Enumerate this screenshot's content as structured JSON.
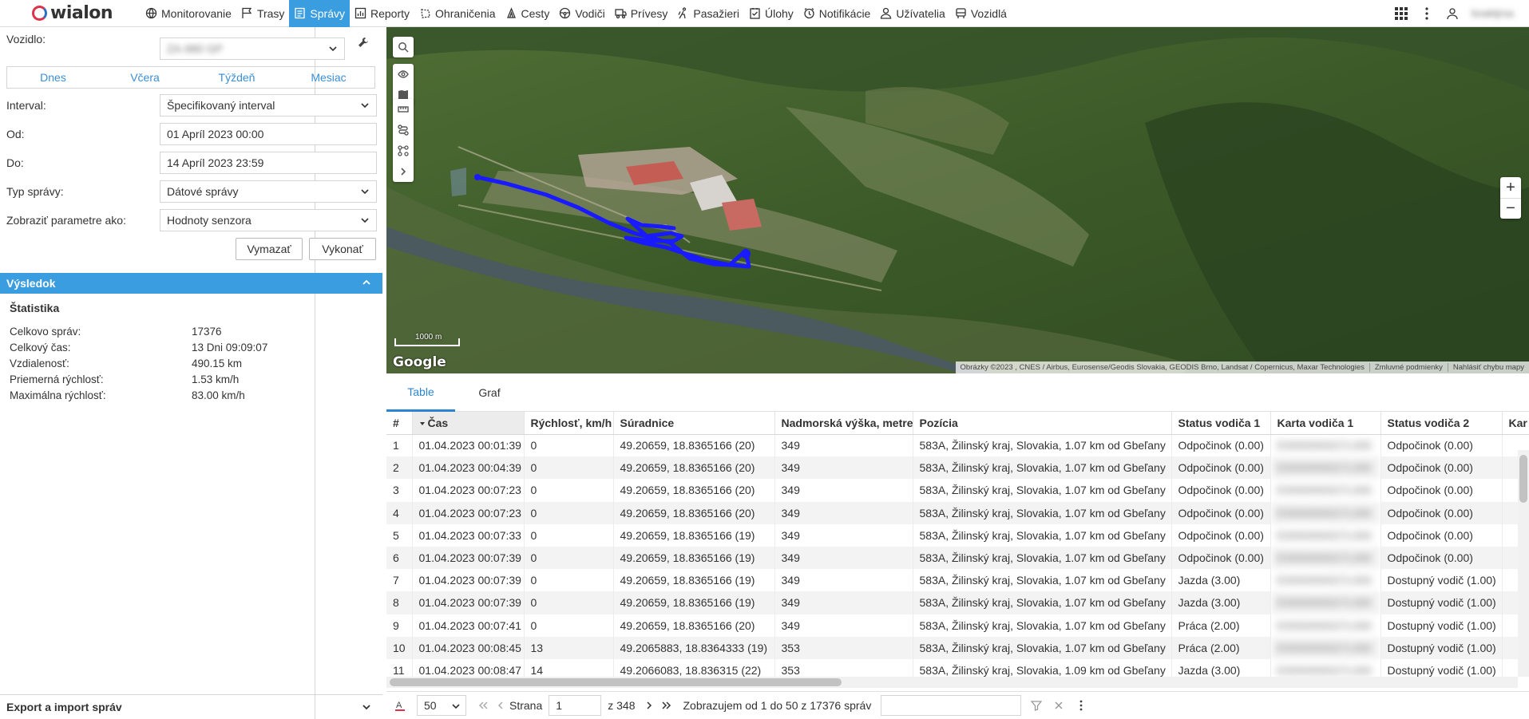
{
  "app": {
    "logo_text": "wialon",
    "username": "boaktjrsa"
  },
  "nav": [
    {
      "label": "Monitorovanie",
      "icon": "globe-icon"
    },
    {
      "label": "Trasy",
      "icon": "flag-icon"
    },
    {
      "label": "Správy",
      "icon": "messages-icon",
      "active": true
    },
    {
      "label": "Reporty",
      "icon": "report-icon"
    },
    {
      "label": "Ohraničenia",
      "icon": "geofence-icon"
    },
    {
      "label": "Cesty",
      "icon": "route-icon"
    },
    {
      "label": "Vodiči",
      "icon": "steering-wheel-icon"
    },
    {
      "label": "Prívesy",
      "icon": "trailer-icon"
    },
    {
      "label": "Pasažieri",
      "icon": "passenger-icon"
    },
    {
      "label": "Úlohy",
      "icon": "task-icon"
    },
    {
      "label": "Notifikácie",
      "icon": "notification-icon"
    },
    {
      "label": "Užívatelia",
      "icon": "user-icon"
    },
    {
      "label": "Vozidlá",
      "icon": "vehicle-icon"
    }
  ],
  "form": {
    "vehicle_label": "Vozidlo:",
    "vehicle_value": "ZA-980 GP",
    "quick": [
      "Dnes",
      "Včera",
      "Týždeň",
      "Mesiac"
    ],
    "interval_label": "Interval:",
    "interval_value": "Špecifikovaný interval",
    "from_label": "Od:",
    "from_value": "01 Apríl 2023 00:00",
    "to_label": "Do:",
    "to_value": "14 Apríl 2023 23:59",
    "type_label": "Typ správy:",
    "type_value": "Dátové správy",
    "params_label": "Zobraziť parametre ako:",
    "params_value": "Hodnoty senzora",
    "clear_label": "Vymazať",
    "execute_label": "Vykonať"
  },
  "result": {
    "header": "Výsledok",
    "stats_title": "Štatistika",
    "stats": [
      {
        "k": "Celkovo správ:",
        "v": "17376"
      },
      {
        "k": "Celkový čas:",
        "v": "13 Dni 09:09:07"
      },
      {
        "k": "Vzdialenosť:",
        "v": "490.15 km"
      },
      {
        "k": "Priemerná rýchlosť:",
        "v": "1.53 km/h"
      },
      {
        "k": "Maximálna rýchlosť:",
        "v": "83.00 km/h"
      }
    ]
  },
  "export_label": "Export a import správ",
  "map": {
    "scale_label": "1000 m",
    "google": "Google",
    "attribution": [
      "Obrázky ©2023 , CNES / Airbus, Eurosense/Geodis Slovakia, GEODIS Brno, Landsat / Copernicus, Maxar Technologies",
      "Zmluvné podmienky",
      "Nahlásiť chybu mapy"
    ],
    "zoom_in": "+",
    "zoom_out": "−",
    "track_color": "#1a1aff"
  },
  "tabs": [
    {
      "label": "Table",
      "active": true
    },
    {
      "label": "Graf"
    }
  ],
  "table": {
    "columns": [
      "#",
      "Čas",
      "Rýchlosť, km/h",
      "Súradnice",
      "Nadmorská výška, metre",
      "Pozícia",
      "Status vodiča 1",
      "Karta vodiča 1",
      "Status vodiča 2",
      "Kar"
    ],
    "rows": [
      [
        "1",
        "01.04.2023 00:01:39",
        "0",
        "49.20659, 18.8365166 (20)",
        "349",
        "583A, Žilinský kraj, Slovakia, 1.07 km od Gbeľany",
        "Odpočinok (0.00)",
        "E0000000027L000",
        "Odpočinok (0.00)"
      ],
      [
        "2",
        "01.04.2023 00:04:39",
        "0",
        "49.20659, 18.8365166 (20)",
        "349",
        "583A, Žilinský kraj, Slovakia, 1.07 km od Gbeľany",
        "Odpočinok (0.00)",
        "E0000000027L000",
        "Odpočinok (0.00)"
      ],
      [
        "3",
        "01.04.2023 00:07:23",
        "0",
        "49.20659, 18.8365166 (20)",
        "349",
        "583A, Žilinský kraj, Slovakia, 1.07 km od Gbeľany",
        "Odpočinok (0.00)",
        "E0000000027L000",
        "Odpočinok (0.00)"
      ],
      [
        "4",
        "01.04.2023 00:07:23",
        "0",
        "49.20659, 18.8365166 (20)",
        "349",
        "583A, Žilinský kraj, Slovakia, 1.07 km od Gbeľany",
        "Odpočinok (0.00)",
        "E0000000027L000",
        "Odpočinok (0.00)"
      ],
      [
        "5",
        "01.04.2023 00:07:33",
        "0",
        "49.20659, 18.8365166 (19)",
        "349",
        "583A, Žilinský kraj, Slovakia, 1.07 km od Gbeľany",
        "Odpočinok (0.00)",
        "E0000000027L000",
        "Odpočinok (0.00)"
      ],
      [
        "6",
        "01.04.2023 00:07:39",
        "0",
        "49.20659, 18.8365166 (19)",
        "349",
        "583A, Žilinský kraj, Slovakia, 1.07 km od Gbeľany",
        "Odpočinok (0.00)",
        "E0000000027L000",
        "Odpočinok (0.00)"
      ],
      [
        "7",
        "01.04.2023 00:07:39",
        "0",
        "49.20659, 18.8365166 (19)",
        "349",
        "583A, Žilinský kraj, Slovakia, 1.07 km od Gbeľany",
        "Jazda (3.00)",
        "E0000000027L000",
        "Dostupný vodič (1.00)"
      ],
      [
        "8",
        "01.04.2023 00:07:39",
        "0",
        "49.20659, 18.8365166 (19)",
        "349",
        "583A, Žilinský kraj, Slovakia, 1.07 km od Gbeľany",
        "Jazda (3.00)",
        "E0000000027L000",
        "Dostupný vodič (1.00)"
      ],
      [
        "9",
        "01.04.2023 00:07:41",
        "0",
        "49.20659, 18.8365166 (20)",
        "349",
        "583A, Žilinský kraj, Slovakia, 1.07 km od Gbeľany",
        "Práca (2.00)",
        "E0000000027L000",
        "Dostupný vodič (1.00)"
      ],
      [
        "10",
        "01.04.2023 00:08:45",
        "13",
        "49.2065883, 18.8364333 (19)",
        "353",
        "583A, Žilinský kraj, Slovakia, 1.07 km od Gbeľany",
        "Práca (2.00)",
        "E0000000027L000",
        "Dostupný vodič (1.00)"
      ],
      [
        "11",
        "01.04.2023 00:08:47",
        "14",
        "49.2066083, 18.836315 (22)",
        "353",
        "583A, Žilinský kraj, Slovakia, 1.09 km od Gbeľany",
        "Jazda (3.00)",
        "E0000000027L000",
        "Dostupný vodič (1.00)"
      ]
    ]
  },
  "pager": {
    "per_page": "50",
    "page_label": "Strana",
    "page_value": "1",
    "of_label": "z 348",
    "showing": "Zobrazujem od 1 do 50 z 17376 správ"
  }
}
